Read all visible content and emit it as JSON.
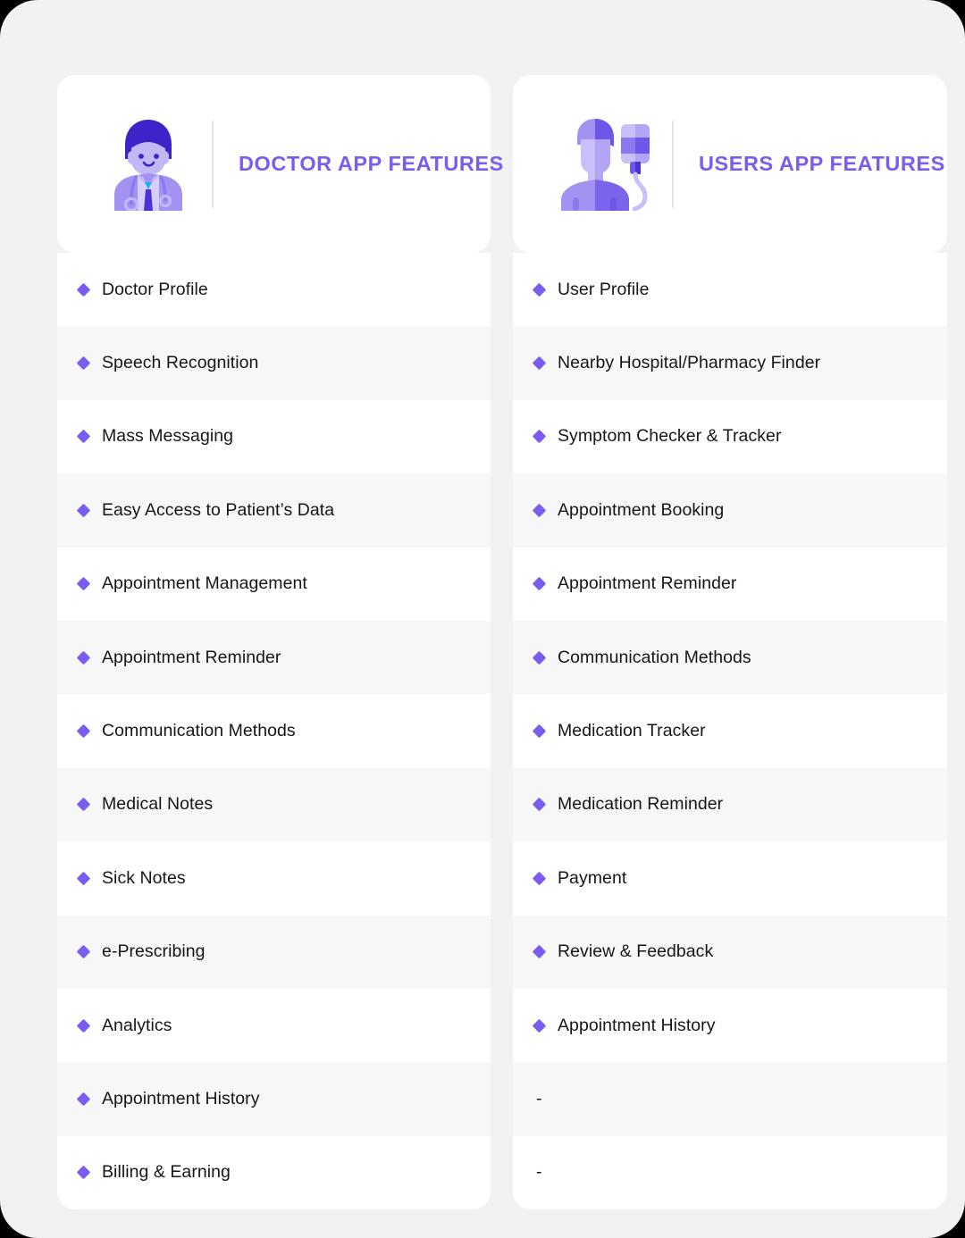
{
  "theme": {
    "accent": "#7c5cf0",
    "page_background": "#f2f2f3",
    "card_background": "#ffffff",
    "row_alt_background": "#f7f7f8",
    "text": "#16161a",
    "divider": "#e4e4e7"
  },
  "columns": [
    {
      "id": "doctor-app",
      "icon": "doctor-avatar-icon",
      "title": "DOCTOR APP FEATURES",
      "features": [
        "Doctor Profile",
        "Speech Recognition",
        "Mass Messaging",
        "Easy Access to Patient’s Data",
        "Appointment Management",
        "Appointment Reminder",
        "Communication Methods",
        "Medical Notes",
        "Sick Notes",
        "e-Prescribing",
        "Analytics",
        "Appointment History",
        "Billing & Earning"
      ]
    },
    {
      "id": "users-app",
      "icon": "patient-iv-drip-icon",
      "title": "USERS APP FEATURES",
      "features": [
        "User Profile",
        "Nearby Hospital/Pharmacy Finder",
        "Symptom Checker & Tracker",
        "Appointment Booking",
        "Appointment Reminder",
        "Communication Methods",
        "Medication Tracker",
        "Medication Reminder",
        "Payment",
        "Review & Feedback",
        "Appointment History",
        "-",
        "-"
      ]
    }
  ]
}
